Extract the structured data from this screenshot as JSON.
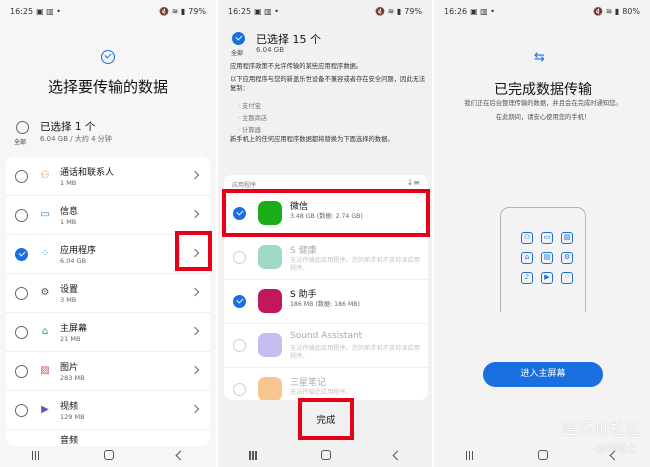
{
  "panel1": {
    "status": {
      "time": "16:25",
      "battery": "79%"
    },
    "title": "选择要传输的数据",
    "select_all": {
      "label": "全部",
      "title": "已选择 1 个",
      "subtitle": "6.04 GB / 大约 4 分钟"
    },
    "items": [
      {
        "name": "通话和联系人",
        "size": "1 MB",
        "icon": "person-icon",
        "checked": false
      },
      {
        "name": "信息",
        "size": "1 MB",
        "icon": "message-icon",
        "checked": false
      },
      {
        "name": "应用程序",
        "size": "6.04 GB",
        "icon": "apps-grid-icon",
        "checked": true
      },
      {
        "name": "设置",
        "size": "3 MB",
        "icon": "gear-icon",
        "checked": false
      },
      {
        "name": "主屏幕",
        "size": "21 MB",
        "icon": "home-icon",
        "checked": false
      },
      {
        "name": "图片",
        "size": "283 MB",
        "icon": "image-icon",
        "checked": false
      },
      {
        "name": "视频",
        "size": "129 MB",
        "icon": "video-icon",
        "checked": false
      },
      {
        "name": "音频",
        "size": "",
        "icon": "audio-icon",
        "checked": false
      }
    ]
  },
  "panel2": {
    "status": {
      "time": "16:25",
      "battery": "79%"
    },
    "all_label": "全部",
    "header_title": "已选择 15 个",
    "header_size": "6.04 GB",
    "desc1": "应用程序政策不允许传输的某些应用程序数据。",
    "desc2": "以下应用程序与您的新盖乐世设备不兼容或者存在安全问题，因此无法复制：",
    "bullets": [
      "· 支付宝",
      "· 主题商店",
      "· 计算器"
    ],
    "desc3": "新手机上的任何应用程序数据都将替换为下面选择的数据。",
    "list_caption": "应用程序",
    "apps": [
      {
        "name": "微信",
        "size": "3.48 GB (数据: 2.74 GB)",
        "checked": true,
        "disabled": false,
        "color": "#1aad19"
      },
      {
        "name": "S 健康",
        "size": "无法传输此应用程序。您的新手机不支持该应用程序。",
        "checked": false,
        "disabled": true,
        "color": "#3fb68b"
      },
      {
        "name": "S 助手",
        "size": "186 MB (数据: 186 MB)",
        "checked": true,
        "disabled": false,
        "color": "#c2185b"
      },
      {
        "name": "Sound Assistant",
        "size": "无法传输此应用程序。您的新手机不支持该应用程序。",
        "checked": false,
        "disabled": true,
        "color": "#7c6fd8"
      },
      {
        "name": "三星笔记",
        "size": "无法传输此应用程序。",
        "checked": false,
        "disabled": true,
        "color": "#f08a24"
      }
    ],
    "done_label": "完成"
  },
  "panel3": {
    "status": {
      "time": "16:26",
      "battery": "80%"
    },
    "title": "已完成数据传输",
    "msg1": "我们正在后台整理传输的数据，并且会在完成时通知您。",
    "msg2": "在此期间，请安心使用您的手机！",
    "home_button": "进入主屏幕",
    "watermark1": "盖乐世社区",
    "watermark2": "@泡泡土"
  }
}
